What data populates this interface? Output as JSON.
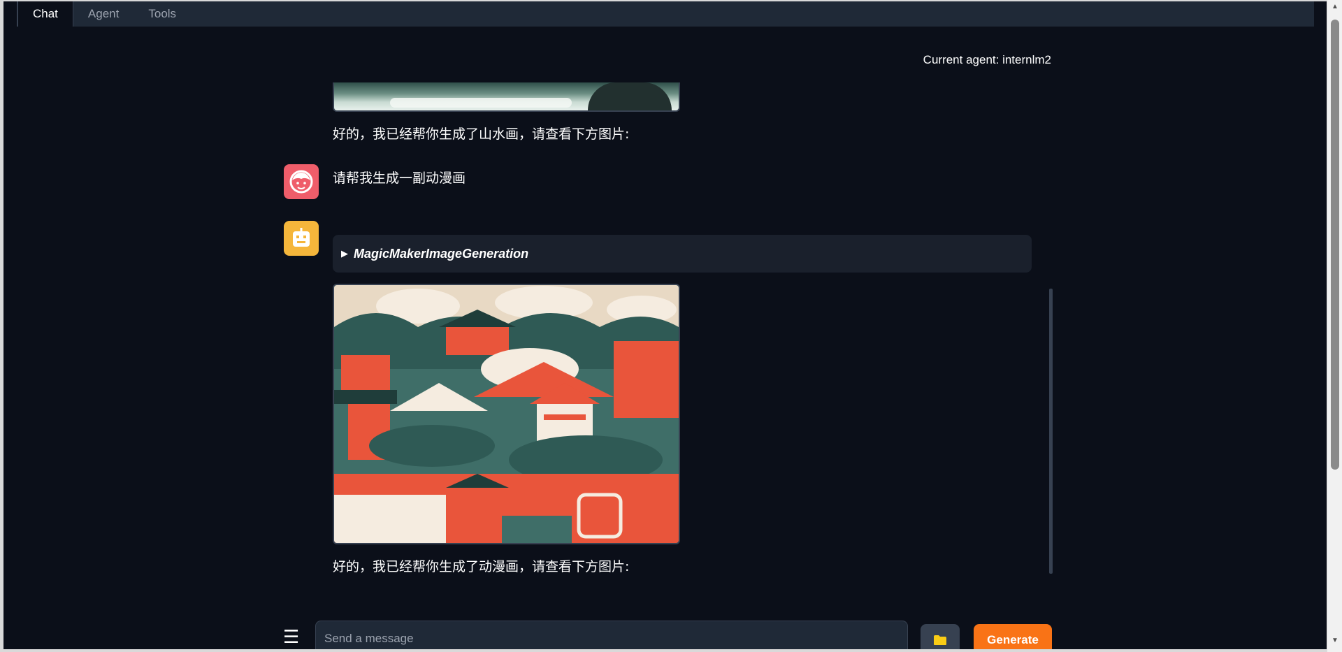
{
  "tabs": [
    {
      "label": "Chat",
      "active": true
    },
    {
      "label": "Agent",
      "active": false
    },
    {
      "label": "Tools",
      "active": false
    }
  ],
  "header": {
    "current_agent": "Current agent: internlm2"
  },
  "messages": {
    "prev_bot_reply": "好的，我已经帮你生成了山水画，请查看下方图片:",
    "user_request": "请帮我生成一副动漫画",
    "tool_name": "MagicMakerImageGeneration",
    "bot_reply": "好的，我已经帮你生成了动漫画，请查看下方图片:"
  },
  "input": {
    "placeholder": "Send a message",
    "value": ""
  },
  "buttons": {
    "menu_glyph": "☰",
    "generate_label": "Generate",
    "upload_icon": "folder-icon"
  },
  "colors": {
    "background": "#0b0f19",
    "generate_accent": "#f97316",
    "user_avatar": "#ef5d6a",
    "bot_avatar": "#f5b63b"
  }
}
